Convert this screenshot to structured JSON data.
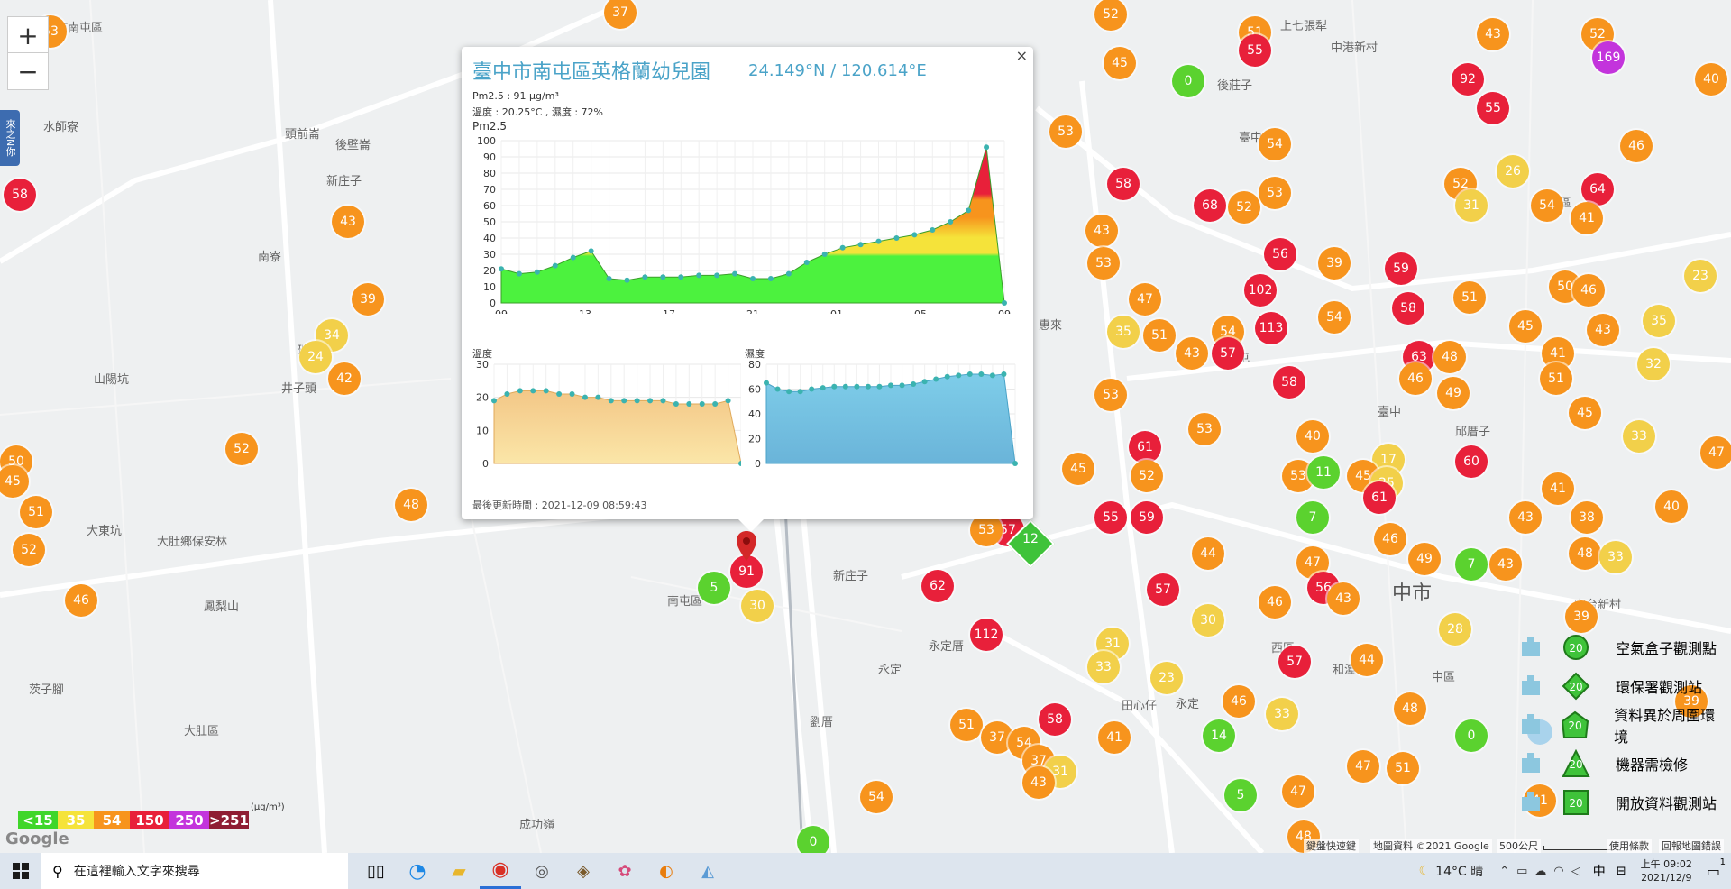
{
  "popup": {
    "title": "臺中市南屯區英格蘭幼兒園",
    "coords": "24.149°N / 120.614°E",
    "pm_line": "Pm2.5 : 91 μg/m³",
    "weather_line": "溫度 : 20.25°C , 濕度 : 72%",
    "pm_label": "Pm2.5",
    "temp_label": "溫度",
    "humid_label": "濕度",
    "updated": "最後更新時間 : 2021-12-09 08:59:43",
    "close": "×"
  },
  "chart_data": [
    {
      "type": "area",
      "title": "Pm2.5",
      "x_ticks": [
        "09",
        "13",
        "17",
        "21",
        "01",
        "05",
        "09"
      ],
      "y_ticks": [
        "100",
        "90",
        "80",
        "70",
        "60",
        "50",
        "40",
        "30",
        "20",
        "10",
        "0"
      ],
      "ylim": [
        0,
        100
      ],
      "values": [
        21,
        18,
        19,
        23,
        28,
        32,
        15,
        14,
        16,
        16,
        16,
        17,
        17,
        18,
        15,
        15,
        18,
        25,
        30,
        34,
        36,
        38,
        40,
        42,
        45,
        50,
        57,
        96,
        0
      ]
    },
    {
      "type": "area",
      "title": "溫度",
      "y_ticks": [
        "30",
        "20",
        "10",
        "0"
      ],
      "ylim": [
        0,
        30
      ],
      "values": [
        19,
        21,
        22,
        22,
        22,
        21,
        21,
        20,
        20,
        19,
        19,
        19,
        19,
        19,
        18,
        18,
        18,
        18,
        19,
        0
      ]
    },
    {
      "type": "area",
      "title": "濕度",
      "y_ticks": [
        "80",
        "60",
        "40",
        "20",
        "0"
      ],
      "ylim": [
        0,
        80
      ],
      "values": [
        65,
        60,
        58,
        58,
        60,
        61,
        62,
        62,
        62,
        62,
        62,
        63,
        63,
        64,
        66,
        68,
        70,
        71,
        72,
        72,
        71,
        72,
        0
      ]
    }
  ],
  "map": {
    "places": [
      {
        "text": "臺中市",
        "x": "",
        "y": ""
      }
    ],
    "markers": [
      {
        "v": "37",
        "c": "#f7941d",
        "x": 688,
        "y": 14
      },
      {
        "v": "52",
        "c": "#f7941d",
        "x": 1232,
        "y": 16
      },
      {
        "v": "53",
        "c": "#f7941d",
        "x": 56,
        "y": 35
      },
      {
        "v": "51",
        "c": "#f7941d",
        "x": 1392,
        "y": 36
      },
      {
        "v": "55",
        "c": "#e8203a",
        "x": 1392,
        "y": 56
      },
      {
        "v": "43",
        "c": "#f7941d",
        "x": 1656,
        "y": 38
      },
      {
        "v": "52",
        "c": "#f7941d",
        "x": 1772,
        "y": 38
      },
      {
        "v": "169",
        "c": "#c334dc",
        "x": 1784,
        "y": 64
      },
      {
        "v": "45",
        "c": "#f7941d",
        "x": 1242,
        "y": 70
      },
      {
        "v": "0",
        "c": "#5bd22f",
        "x": 1318,
        "y": 90
      },
      {
        "v": "92",
        "c": "#e8203a",
        "x": 1628,
        "y": 88
      },
      {
        "v": "55",
        "c": "#e8203a",
        "x": 1656,
        "y": 120
      },
      {
        "v": "40",
        "c": "#f7941d",
        "x": 1898,
        "y": 88
      },
      {
        "v": "53",
        "c": "#f7941d",
        "x": 1182,
        "y": 146
      },
      {
        "v": "54",
        "c": "#f7941d",
        "x": 1414,
        "y": 160
      },
      {
        "v": "46",
        "c": "#f7941d",
        "x": 1815,
        "y": 162
      },
      {
        "v": "58",
        "c": "#e8203a",
        "x": 22,
        "y": 216
      },
      {
        "v": "58",
        "c": "#e8203a",
        "x": 1246,
        "y": 204
      },
      {
        "v": "26",
        "c": "#f2d04a",
        "x": 1678,
        "y": 190
      },
      {
        "v": "52",
        "c": "#f7941d",
        "x": 1620,
        "y": 204
      },
      {
        "v": "64",
        "c": "#e8203a",
        "x": 1772,
        "y": 210
      },
      {
        "v": "53",
        "c": "#f7941d",
        "x": 1414,
        "y": 214
      },
      {
        "v": "68",
        "c": "#e8203a",
        "x": 1342,
        "y": 228
      },
      {
        "v": "52",
        "c": "#f7941d",
        "x": 1380,
        "y": 230
      },
      {
        "v": "31",
        "c": "#f2d04a",
        "x": 1632,
        "y": 228
      },
      {
        "v": "54",
        "c": "#f7941d",
        "x": 1716,
        "y": 228
      },
      {
        "v": "41",
        "c": "#f7941d",
        "x": 1760,
        "y": 242
      },
      {
        "v": "43",
        "c": "#f7941d",
        "x": 386,
        "y": 246
      },
      {
        "v": "43",
        "c": "#f7941d",
        "x": 1222,
        "y": 256
      },
      {
        "v": "53",
        "c": "#f7941d",
        "x": 1224,
        "y": 292
      },
      {
        "v": "56",
        "c": "#e8203a",
        "x": 1420,
        "y": 282
      },
      {
        "v": "39",
        "c": "#f7941d",
        "x": 1480,
        "y": 292
      },
      {
        "v": "59",
        "c": "#e8203a",
        "x": 1554,
        "y": 298
      },
      {
        "v": "23",
        "c": "#f2d04a",
        "x": 1886,
        "y": 306
      },
      {
        "v": "102",
        "c": "#e8203a",
        "x": 1398,
        "y": 322
      },
      {
        "v": "47",
        "c": "#f7941d",
        "x": 1270,
        "y": 332
      },
      {
        "v": "51",
        "c": "#f7941d",
        "x": 1630,
        "y": 330
      },
      {
        "v": "50",
        "c": "#f7941d",
        "x": 1736,
        "y": 318
      },
      {
        "v": "46",
        "c": "#f7941d",
        "x": 1762,
        "y": 322
      },
      {
        "v": "39",
        "c": "#f7941d",
        "x": 408,
        "y": 332
      },
      {
        "v": "58",
        "c": "#e8203a",
        "x": 1562,
        "y": 342
      },
      {
        "v": "54",
        "c": "#f7941d",
        "x": 1480,
        "y": 352
      },
      {
        "v": "35",
        "c": "#f2d04a",
        "x": 1840,
        "y": 356
      },
      {
        "v": "35",
        "c": "#f2d04a",
        "x": 1246,
        "y": 368
      },
      {
        "v": "51",
        "c": "#f7941d",
        "x": 1286,
        "y": 372
      },
      {
        "v": "113",
        "c": "#e8203a",
        "x": 1410,
        "y": 364
      },
      {
        "v": "54",
        "c": "#f7941d",
        "x": 1362,
        "y": 368
      },
      {
        "v": "45",
        "c": "#f7941d",
        "x": 1692,
        "y": 362
      },
      {
        "v": "43",
        "c": "#f7941d",
        "x": 1778,
        "y": 366
      },
      {
        "v": "34",
        "c": "#f2d04a",
        "x": 368,
        "y": 372
      },
      {
        "v": "24",
        "c": "#f2d04a",
        "x": 350,
        "y": 396
      },
      {
        "v": "43",
        "c": "#f7941d",
        "x": 1322,
        "y": 392
      },
      {
        "v": "57",
        "c": "#e8203a",
        "x": 1362,
        "y": 392
      },
      {
        "v": "63",
        "c": "#e8203a",
        "x": 1574,
        "y": 396
      },
      {
        "v": "48",
        "c": "#f7941d",
        "x": 1608,
        "y": 396
      },
      {
        "v": "41",
        "c": "#f7941d",
        "x": 1728,
        "y": 392
      },
      {
        "v": "32",
        "c": "#f2d04a",
        "x": 1834,
        "y": 404
      },
      {
        "v": "42",
        "c": "#f7941d",
        "x": 382,
        "y": 420
      },
      {
        "v": "46",
        "c": "#f7941d",
        "x": 1570,
        "y": 420
      },
      {
        "v": "51",
        "c": "#f7941d",
        "x": 1726,
        "y": 420
      },
      {
        "v": "58",
        "c": "#e8203a",
        "x": 1430,
        "y": 424
      },
      {
        "v": "53",
        "c": "#f7941d",
        "x": 1232,
        "y": 438
      },
      {
        "v": "49",
        "c": "#f7941d",
        "x": 1612,
        "y": 436
      },
      {
        "v": "45",
        "c": "#f7941d",
        "x": 1758,
        "y": 458
      },
      {
        "v": "53",
        "c": "#f7941d",
        "x": 1336,
        "y": 476
      },
      {
        "v": "40",
        "c": "#f7941d",
        "x": 1456,
        "y": 484
      },
      {
        "v": "33",
        "c": "#f2d04a",
        "x": 1818,
        "y": 484
      },
      {
        "v": "61",
        "c": "#e8203a",
        "x": 1270,
        "y": 496
      },
      {
        "v": "52",
        "c": "#f7941d",
        "x": 268,
        "y": 498
      },
      {
        "v": "47",
        "c": "#f7941d",
        "x": 1904,
        "y": 502
      },
      {
        "v": "50",
        "c": "#f7941d",
        "x": 18,
        "y": 512
      },
      {
        "v": "45",
        "c": "#f7941d",
        "x": 14,
        "y": 534
      },
      {
        "v": "60",
        "c": "#e8203a",
        "x": 1632,
        "y": 512
      },
      {
        "v": "17",
        "c": "#f2d04a",
        "x": 1540,
        "y": 510
      },
      {
        "v": "45",
        "c": "#f7941d",
        "x": 1196,
        "y": 520
      },
      {
        "v": "53",
        "c": "#f7941d",
        "x": 1440,
        "y": 528
      },
      {
        "v": "11",
        "c": "#5bd22f",
        "x": 1468,
        "y": 524
      },
      {
        "v": "45",
        "c": "#f7941d",
        "x": 1512,
        "y": 528
      },
      {
        "v": "25",
        "c": "#f2d04a",
        "x": 1538,
        "y": 536
      },
      {
        "v": "52",
        "c": "#f7941d",
        "x": 1272,
        "y": 528
      },
      {
        "v": "41",
        "c": "#f7941d",
        "x": 1728,
        "y": 542
      },
      {
        "v": "61",
        "c": "#e8203a",
        "x": 1530,
        "y": 552
      },
      {
        "v": "40",
        "c": "#f7941d",
        "x": 1854,
        "y": 562
      },
      {
        "v": "48",
        "c": "#f7941d",
        "x": 456,
        "y": 560
      },
      {
        "v": "51",
        "c": "#f7941d",
        "x": 40,
        "y": 568
      },
      {
        "v": "55",
        "c": "#e8203a",
        "x": 1232,
        "y": 574
      },
      {
        "v": "59",
        "c": "#e8203a",
        "x": 1272,
        "y": 574
      },
      {
        "v": "7",
        "c": "#5bd22f",
        "x": 1456,
        "y": 574
      },
      {
        "v": "43",
        "c": "#f7941d",
        "x": 1692,
        "y": 574
      },
      {
        "v": "38",
        "c": "#f7941d",
        "x": 1760,
        "y": 574
      },
      {
        "v": "57",
        "c": "#e8203a",
        "x": 1118,
        "y": 588
      },
      {
        "v": "53",
        "c": "#f7941d",
        "x": 1094,
        "y": 588
      },
      {
        "v": "46",
        "c": "#f7941d",
        "x": 1542,
        "y": 598
      },
      {
        "v": "44",
        "c": "#f7941d",
        "x": 1340,
        "y": 614
      },
      {
        "v": "49",
        "c": "#f7941d",
        "x": 1580,
        "y": 620
      },
      {
        "v": "52",
        "c": "#f7941d",
        "x": 32,
        "y": 610
      },
      {
        "v": "48",
        "c": "#f7941d",
        "x": 1758,
        "y": 614
      },
      {
        "v": "33",
        "c": "#f2d04a",
        "x": 1792,
        "y": 618
      },
      {
        "v": "47",
        "c": "#f7941d",
        "x": 1456,
        "y": 624
      },
      {
        "v": "7",
        "c": "#5bd22f",
        "x": 1632,
        "y": 626
      },
      {
        "v": "43",
        "c": "#f7941d",
        "x": 1670,
        "y": 626
      },
      {
        "v": "91",
        "c": "#e8203a",
        "x": 828,
        "y": 634
      },
      {
        "v": "5",
        "c": "#5bd22f",
        "x": 792,
        "y": 652
      },
      {
        "v": "62",
        "c": "#e8203a",
        "x": 1040,
        "y": 650
      },
      {
        "v": "57",
        "c": "#e8203a",
        "x": 1290,
        "y": 654
      },
      {
        "v": "56",
        "c": "#e8203a",
        "x": 1468,
        "y": 652
      },
      {
        "v": "43",
        "c": "#f7941d",
        "x": 1490,
        "y": 664
      },
      {
        "v": "46",
        "c": "#f7941d",
        "x": 90,
        "y": 666
      },
      {
        "v": "30",
        "c": "#f2d04a",
        "x": 840,
        "y": 672
      },
      {
        "v": "46",
        "c": "#f7941d",
        "x": 1414,
        "y": 668
      },
      {
        "v": "39",
        "c": "#f7941d",
        "x": 1754,
        "y": 684
      },
      {
        "v": "30",
        "c": "#f2d04a",
        "x": 1340,
        "y": 688
      },
      {
        "v": "28",
        "c": "#f2d04a",
        "x": 1614,
        "y": 698
      },
      {
        "v": "112",
        "c": "#e8203a",
        "x": 1094,
        "y": 704
      },
      {
        "v": "31",
        "c": "#f2d04a",
        "x": 1234,
        "y": 714
      },
      {
        "v": "57",
        "c": "#e8203a",
        "x": 1436,
        "y": 734
      },
      {
        "v": "44",
        "c": "#f7941d",
        "x": 1516,
        "y": 732
      },
      {
        "v": "33",
        "c": "#f2d04a",
        "x": 1224,
        "y": 740
      },
      {
        "v": "23",
        "c": "#f2d04a",
        "x": 1294,
        "y": 752
      },
      {
        "v": "46",
        "c": "#f7941d",
        "x": 1374,
        "y": 778
      },
      {
        "v": "33",
        "c": "#f2d04a",
        "x": 1422,
        "y": 792
      },
      {
        "v": "48",
        "c": "#f7941d",
        "x": 1564,
        "y": 786
      },
      {
        "v": "39",
        "c": "#f7941d",
        "x": 1876,
        "y": 778
      },
      {
        "v": "58",
        "c": "#e8203a",
        "x": 1170,
        "y": 798
      },
      {
        "v": "51",
        "c": "#f7941d",
        "x": 1072,
        "y": 804
      },
      {
        "v": "14",
        "c": "#5bd22f",
        "x": 1352,
        "y": 816
      },
      {
        "v": "0",
        "c": "#5bd22f",
        "x": 1632,
        "y": 816
      },
      {
        "v": "37",
        "c": "#f7941d",
        "x": 1106,
        "y": 818
      },
      {
        "v": "54",
        "c": "#f7941d",
        "x": 1136,
        "y": 824
      },
      {
        "v": "41",
        "c": "#f7941d",
        "x": 1236,
        "y": 818
      },
      {
        "v": "37",
        "c": "#f7941d",
        "x": 1152,
        "y": 844
      },
      {
        "v": "31",
        "c": "#f2d04a",
        "x": 1176,
        "y": 856
      },
      {
        "v": "43",
        "c": "#f7941d",
        "x": 1152,
        "y": 868
      },
      {
        "v": "47",
        "c": "#f7941d",
        "x": 1512,
        "y": 850
      },
      {
        "v": "51",
        "c": "#f7941d",
        "x": 1556,
        "y": 852
      },
      {
        "v": "54",
        "c": "#f7941d",
        "x": 972,
        "y": 884
      },
      {
        "v": "5",
        "c": "#5bd22f",
        "x": 1376,
        "y": 882
      },
      {
        "v": "47",
        "c": "#f7941d",
        "x": 1440,
        "y": 878
      },
      {
        "v": "41",
        "c": "#f7941d",
        "x": 1708,
        "y": 888
      },
      {
        "v": "48",
        "c": "#f7941d",
        "x": 1446,
        "y": 928
      },
      {
        "v": "0",
        "c": "#5bd22f",
        "x": 902,
        "y": 934
      }
    ]
  },
  "legend": {
    "items": [
      {
        "num": "20",
        "label": "空氣盒子觀測點"
      },
      {
        "num": "20",
        "label": "環保署觀測站"
      },
      {
        "num": "20",
        "label": "資料異於周圍環境"
      },
      {
        "num": "20",
        "label": "機器需檢修"
      },
      {
        "num": "20",
        "label": "開放資料觀測站"
      }
    ],
    "scale": [
      {
        "label": "<15",
        "color": "#3fd62a"
      },
      {
        "label": "35",
        "color": "#f5e33a"
      },
      {
        "label": "54",
        "color": "#f7941d"
      },
      {
        "label": "150",
        "color": "#e8203a"
      },
      {
        "label": "250",
        "color": "#c334dc"
      },
      {
        "label": ">251",
        "color": "#8f1d33"
      }
    ],
    "unit": "(μg/m³)"
  },
  "map_labels": {
    "zoom_in": "+",
    "zoom_out": "−",
    "side_tab": "來之N你",
    "google": "Google",
    "shortcuts": "鍵盤快速鍵",
    "map_data": "地圖資料 ©2021 Google",
    "scale_bar": "500公尺",
    "terms": "使用條款",
    "report": "回報地圖錯誤",
    "marker_12": "12"
  },
  "taskbar": {
    "search_placeholder": "在這裡輸入文字來搜尋",
    "weather": "14°C 晴",
    "ime": "中",
    "time": "上午 09:02",
    "date": "2021/12/9",
    "notif": "1"
  }
}
